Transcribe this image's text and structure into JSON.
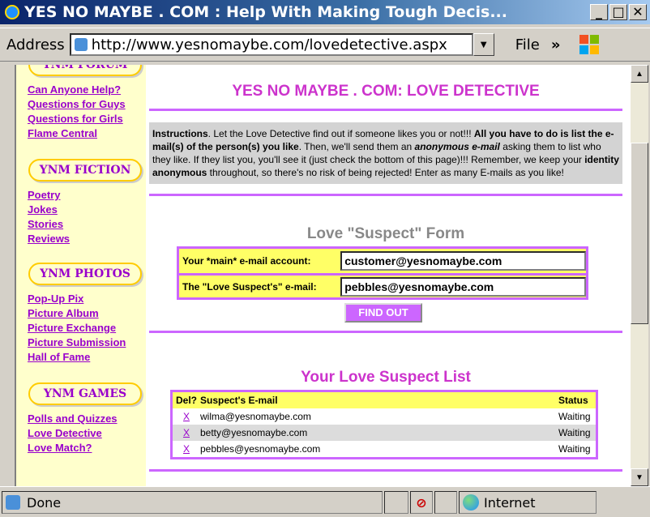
{
  "window": {
    "title": "YES NO MAYBE . COM : Help With Making Tough Decis..."
  },
  "addressbar": {
    "label": "Address",
    "url": "http://www.yesnomaybe.com/lovedetective.aspx",
    "file_menu": "File"
  },
  "sidebar": {
    "sections": [
      {
        "heading": "YNM FORUM",
        "links": [
          "Can Anyone Help?",
          "Questions for Guys",
          "Questions for Girls",
          "Flame Central"
        ]
      },
      {
        "heading": "YNM FICTION",
        "links": [
          "Poetry",
          "Jokes",
          "Stories",
          "Reviews"
        ]
      },
      {
        "heading": "YNM PHOTOS",
        "links": [
          "Pop-Up Pix",
          "Picture Album",
          "Picture Exchange",
          "Picture Submission",
          "Hall of Fame"
        ]
      },
      {
        "heading": "YNM GAMES",
        "links": [
          "Polls and Quizzes",
          "Love Detective",
          "Love Match?"
        ]
      }
    ]
  },
  "main": {
    "page_title": "YES NO MAYBE . COM: LOVE DETECTIVE",
    "instructions": {
      "p1_bold": "Instructions",
      "p1": ". Let the Love Detective find out if someone likes you or not!!! ",
      "p2_bold": "All you have to do is list the e-mail(s) of the person(s) you like",
      "p3": ". Then, we'll send them an ",
      "p4_bi": "anonymous e-mail",
      "p5": " asking them to list who they like. If they list you, you'll see it (just check the bottom of this page)!!! Remember, we keep your ",
      "p6_bold": "identity anonymous",
      "p7": " throughout, so there's no risk of being rejected! Enter as many E-mails as you like!"
    },
    "form": {
      "title": "Love \"Suspect\" Form",
      "main_email_label": "Your *main* e-mail account:",
      "main_email_value": "customer@yesnomaybe.com",
      "suspect_email_label": "The \"Love Suspect's\" e-mail:",
      "suspect_email_value": "pebbles@yesnomaybe.com",
      "submit_label": "FIND OUT"
    },
    "suspect_list": {
      "title": "Your Love Suspect List",
      "headers": {
        "del": "Del?",
        "email": "Suspect's E-mail",
        "status": "Status"
      },
      "rows": [
        {
          "del": "X",
          "email": "wilma@yesnomaybe.com",
          "status": "Waiting"
        },
        {
          "del": "X",
          "email": "betty@yesnomaybe.com",
          "status": "Waiting"
        },
        {
          "del": "X",
          "email": "pebbles@yesnomaybe.com",
          "status": "Waiting"
        }
      ]
    }
  },
  "statusbar": {
    "status": "Done",
    "zone": "Internet"
  }
}
